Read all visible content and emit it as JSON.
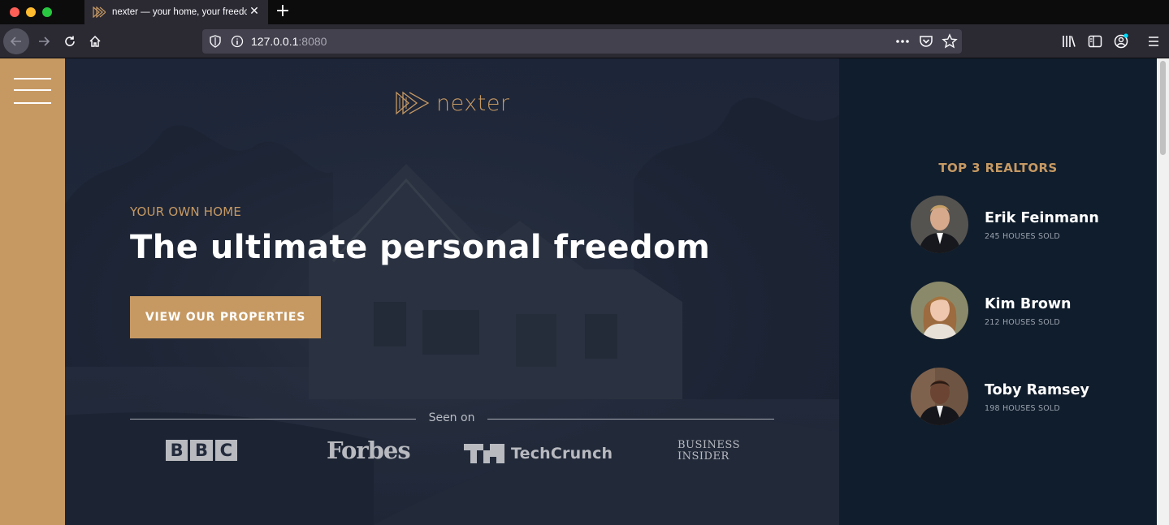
{
  "browser": {
    "tab_title": "nexter — your home, your freedom",
    "url_host": "127.0.0.1",
    "url_port": ":8080",
    "accent": "#c69963"
  },
  "icons": {
    "back": "back-arrow-icon",
    "forward": "forward-arrow-icon",
    "reload": "reload-icon",
    "home": "home-icon",
    "tracking": "shield-icon",
    "info": "info-icon",
    "more": "more-dots-icon",
    "pocket": "pocket-icon",
    "bookmark": "star-icon",
    "library": "library-icon",
    "sidebar": "sidebar-icon",
    "account": "account-icon",
    "menu": "hamburger-menu-icon"
  },
  "page": {
    "logo_text": "nexter",
    "subtitle": "YOUR OWN HOME",
    "headline": "The ultimate personal freedom",
    "cta_label": "VIEW OUR PROPERTIES",
    "seen_on": "Seen on",
    "press": {
      "bbc": [
        "B",
        "B",
        "C"
      ],
      "forbes": "Forbes",
      "techcrunch": "TechCrunch",
      "business_insider_line1": "BUSINESS",
      "business_insider_line2": "INSIDER"
    }
  },
  "realtors": {
    "title": "TOP 3 REALTORS",
    "items": [
      {
        "name": "Erik Feinmann",
        "sold": "245 HOUSES SOLD"
      },
      {
        "name": "Kim Brown",
        "sold": "212 HOUSES SOLD"
      },
      {
        "name": "Toby Ramsey",
        "sold": "198 HOUSES SOLD"
      }
    ]
  }
}
